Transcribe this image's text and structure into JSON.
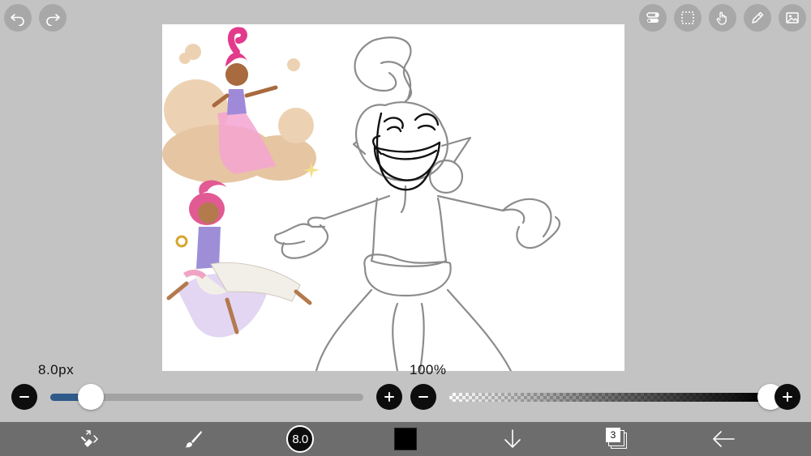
{
  "colors": {
    "background": "#c3c3c3",
    "bottom_bar": "#6d6d6d",
    "slider_fill": "#2f5a8a",
    "canvas": "#ffffff"
  },
  "top_left": {
    "undo_icon": "undo-icon",
    "redo_icon": "redo-icon"
  },
  "top_right": {
    "icons": [
      "toggle-icon",
      "selection-icon",
      "hand-icon",
      "pen-icon",
      "image-icon"
    ]
  },
  "brush_size": {
    "label": "8.0px",
    "value_fraction": 0.13
  },
  "opacity": {
    "label": "100%",
    "value_percent": 100
  },
  "bottom_bar": {
    "brush_size_badge": "8.0",
    "layer_count": "3",
    "current_color": "#000000"
  }
}
